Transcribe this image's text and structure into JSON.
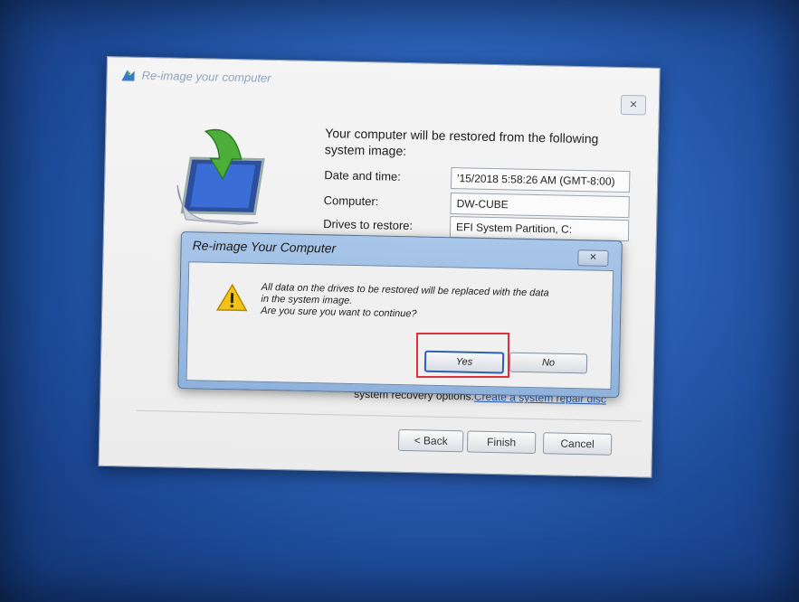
{
  "wizard": {
    "title": "Re-image your computer",
    "close_glyph": "✕",
    "heading": "Your computer will be restored from the following system image:",
    "rows": [
      {
        "label": "Date and time:",
        "value": "'15/2018 5:58:26 AM (GMT-8:00)"
      },
      {
        "label": "Computer:",
        "value": "DW-CUBE"
      },
      {
        "label": "Drives to restore:",
        "value": "EFI System Partition, C:"
      }
    ],
    "repair_prefix": "system recovery options.",
    "repair_link": "Create a system repair disc",
    "buttons": {
      "back": "< Back",
      "finish": "Finish",
      "cancel": "Cancel"
    }
  },
  "confirm_dialog": {
    "title": "Re-image Your Computer",
    "close_glyph": "✕",
    "message_lines": [
      "All data on the drives to be restored will be replaced with the data",
      "in the system image.",
      "Are you sure you want to continue?"
    ],
    "buttons": {
      "yes": "Yes",
      "no": "No"
    }
  },
  "colors": {
    "desktop": "#2b62b8",
    "highlight": "#e0303a",
    "link": "#1f5fc2"
  },
  "icons": {
    "wizard_title": "backup-restore-icon",
    "hero": "restore-computer-icon",
    "warning": "warning-icon"
  }
}
